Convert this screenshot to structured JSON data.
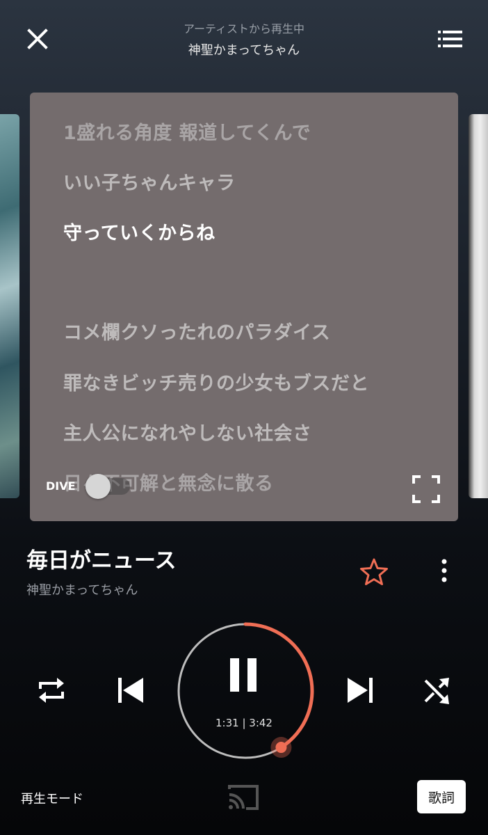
{
  "header": {
    "subtitle": "アーティストから再生中",
    "title": "神聖かまってちゃん"
  },
  "lyrics": {
    "lines": [
      {
        "text": "1盛れる角度 報道してくんで",
        "state": "past"
      },
      {
        "text": "いい子ちゃんキャラ",
        "state": "past"
      },
      {
        "text": "守っていくからね",
        "state": "current"
      },
      {
        "text": "",
        "state": "gap"
      },
      {
        "text": "コメ欄クソったれのパラダイス",
        "state": "upcoming"
      },
      {
        "text": "罪なきビッチ売りの少女もブスだと",
        "state": "upcoming"
      },
      {
        "text": "主人公になれやしない社会さ",
        "state": "upcoming"
      },
      {
        "text": "日々不可解と無念に散る",
        "state": "upcoming"
      }
    ],
    "dive_label": "DIVE",
    "dive_enabled": false
  },
  "song": {
    "title": "毎日がニュース",
    "artist": "神聖かまってちゃん",
    "favorite": false
  },
  "player": {
    "elapsed": "1:31",
    "duration": "3:42",
    "time_text": "1:31 | 3:42",
    "progress": 0.41,
    "state": "playing"
  },
  "footer": {
    "mode_label": "再生モード",
    "lyrics_label": "歌詞"
  },
  "colors": {
    "accent": "#f06e55",
    "lyrics_card": "#746c6d",
    "ring_track": "#bdbdbd"
  },
  "icons": {
    "close": "close-icon",
    "queue": "queue-list-icon",
    "fullscreen": "fullscreen-icon",
    "favorite": "star-outline-icon",
    "more": "more-vertical-icon",
    "repeat": "repeat-icon",
    "previous": "skip-previous-icon",
    "pause": "pause-icon",
    "next": "skip-next-icon",
    "shuffle": "shuffle-icon",
    "cast": "cast-icon"
  }
}
